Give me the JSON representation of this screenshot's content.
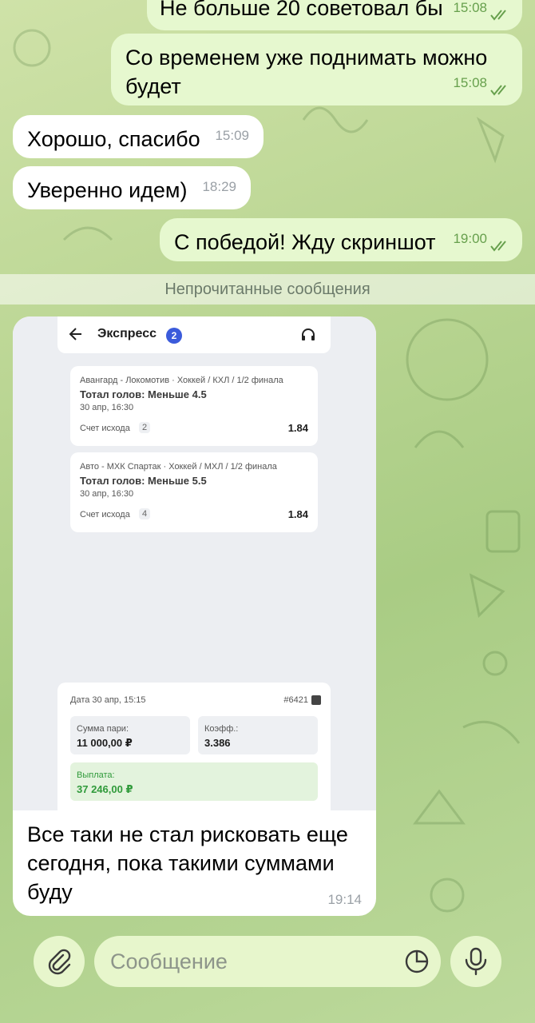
{
  "messages": [
    {
      "dir": "out",
      "text": "Не больше 20 советовал бы",
      "time": "15:08"
    },
    {
      "dir": "out",
      "text": "Со временем уже поднимать можно будет",
      "time": "15:08"
    },
    {
      "dir": "in",
      "text": "Хорошо, спасибо",
      "time": "15:09"
    },
    {
      "dir": "in",
      "text": "Уверенно идем)",
      "time": "18:29"
    },
    {
      "dir": "out",
      "text": "С победой! Жду скриншот",
      "time": "19:00"
    }
  ],
  "unread_divider": "Непрочитанные сообщения",
  "photo_message": {
    "screenshot": {
      "title": "Экспресс",
      "count": "2",
      "bets": [
        {
          "event": "Авангард - Локомотив · Хоккей / КХЛ / 1/2 финала",
          "market": "Тотал голов: Меньше 4.5",
          "date": "30 апр, 16:30",
          "outcome_label": "Счет исхода",
          "outcome_value": "2",
          "odds": "1.84"
        },
        {
          "event": "Авто - МХК Спартак · Хоккей / МХЛ / 1/2 финала",
          "market": "Тотал голов: Меньше 5.5",
          "date": "30 апр, 16:30",
          "outcome_label": "Счет исхода",
          "outcome_value": "4",
          "odds": "1.84"
        }
      ],
      "summary": {
        "date": "Дата 30 апр, 15:15",
        "id": "#6421",
        "stake_label": "Сумма пари:",
        "stake_value": "11 000,00 ₽",
        "coef_label": "Коэфф.:",
        "coef_value": "3.386",
        "payout_label": "Выплата:",
        "payout_value": "37 246,00 ₽"
      }
    },
    "caption": "Все таки не стал рисковать еще сегодня, пока такими суммами буду",
    "time": "19:14"
  },
  "composer": {
    "placeholder": "Сообщение",
    "icons": {
      "attach": "paperclip-icon",
      "sticker": "sticker-icon",
      "mic": "microphone-icon"
    }
  },
  "colors": {
    "outgoing": "#e6f8cf",
    "incoming": "#ffffff",
    "accent": "#67a04d"
  }
}
